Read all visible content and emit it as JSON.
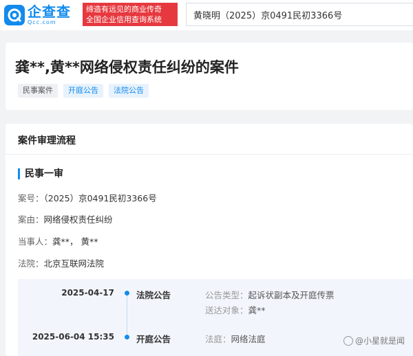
{
  "header": {
    "logo_cn": "企查查",
    "logo_en": "Qcc.com",
    "slogan_line1": "缔造有远见的商业传奇",
    "slogan_line2": "全国企业信用查询系统",
    "search_value": "黄晓明（2025）京0491民初3366号"
  },
  "case": {
    "title": "龚**,黄**网络侵权责任纠纷的案件",
    "tags": [
      "民事案件",
      "开庭公告",
      "法院公告"
    ]
  },
  "process": {
    "section_title": "案件审理流程",
    "stage_title": "民事一审",
    "fields": [
      {
        "key": "案号：",
        "value": "（2025）京0491民初3366号"
      },
      {
        "key": "案由：",
        "value": "网络侵权责任纠纷"
      },
      {
        "key": "当事人：",
        "value": "龚**，  黄**"
      },
      {
        "key": "法院：",
        "value": "北京互联网法院"
      }
    ],
    "timeline": [
      {
        "date": "2025-04-17",
        "type": "法院公告",
        "details": [
          {
            "key": "公告类型：",
            "value": "起诉状副本及开庭传票"
          },
          {
            "key": "送达对象：",
            "value": "龚**"
          }
        ]
      },
      {
        "date": "2025-06-04 15:35",
        "type": "开庭公告",
        "details": [
          {
            "key": "法庭：",
            "value": "网络法庭"
          }
        ]
      }
    ]
  },
  "watermark": "@小星就是闻",
  "colors": {
    "brand": "#128bed",
    "slogan_bg": "#e6393f",
    "timeline_bg": "#f2f6fc"
  }
}
